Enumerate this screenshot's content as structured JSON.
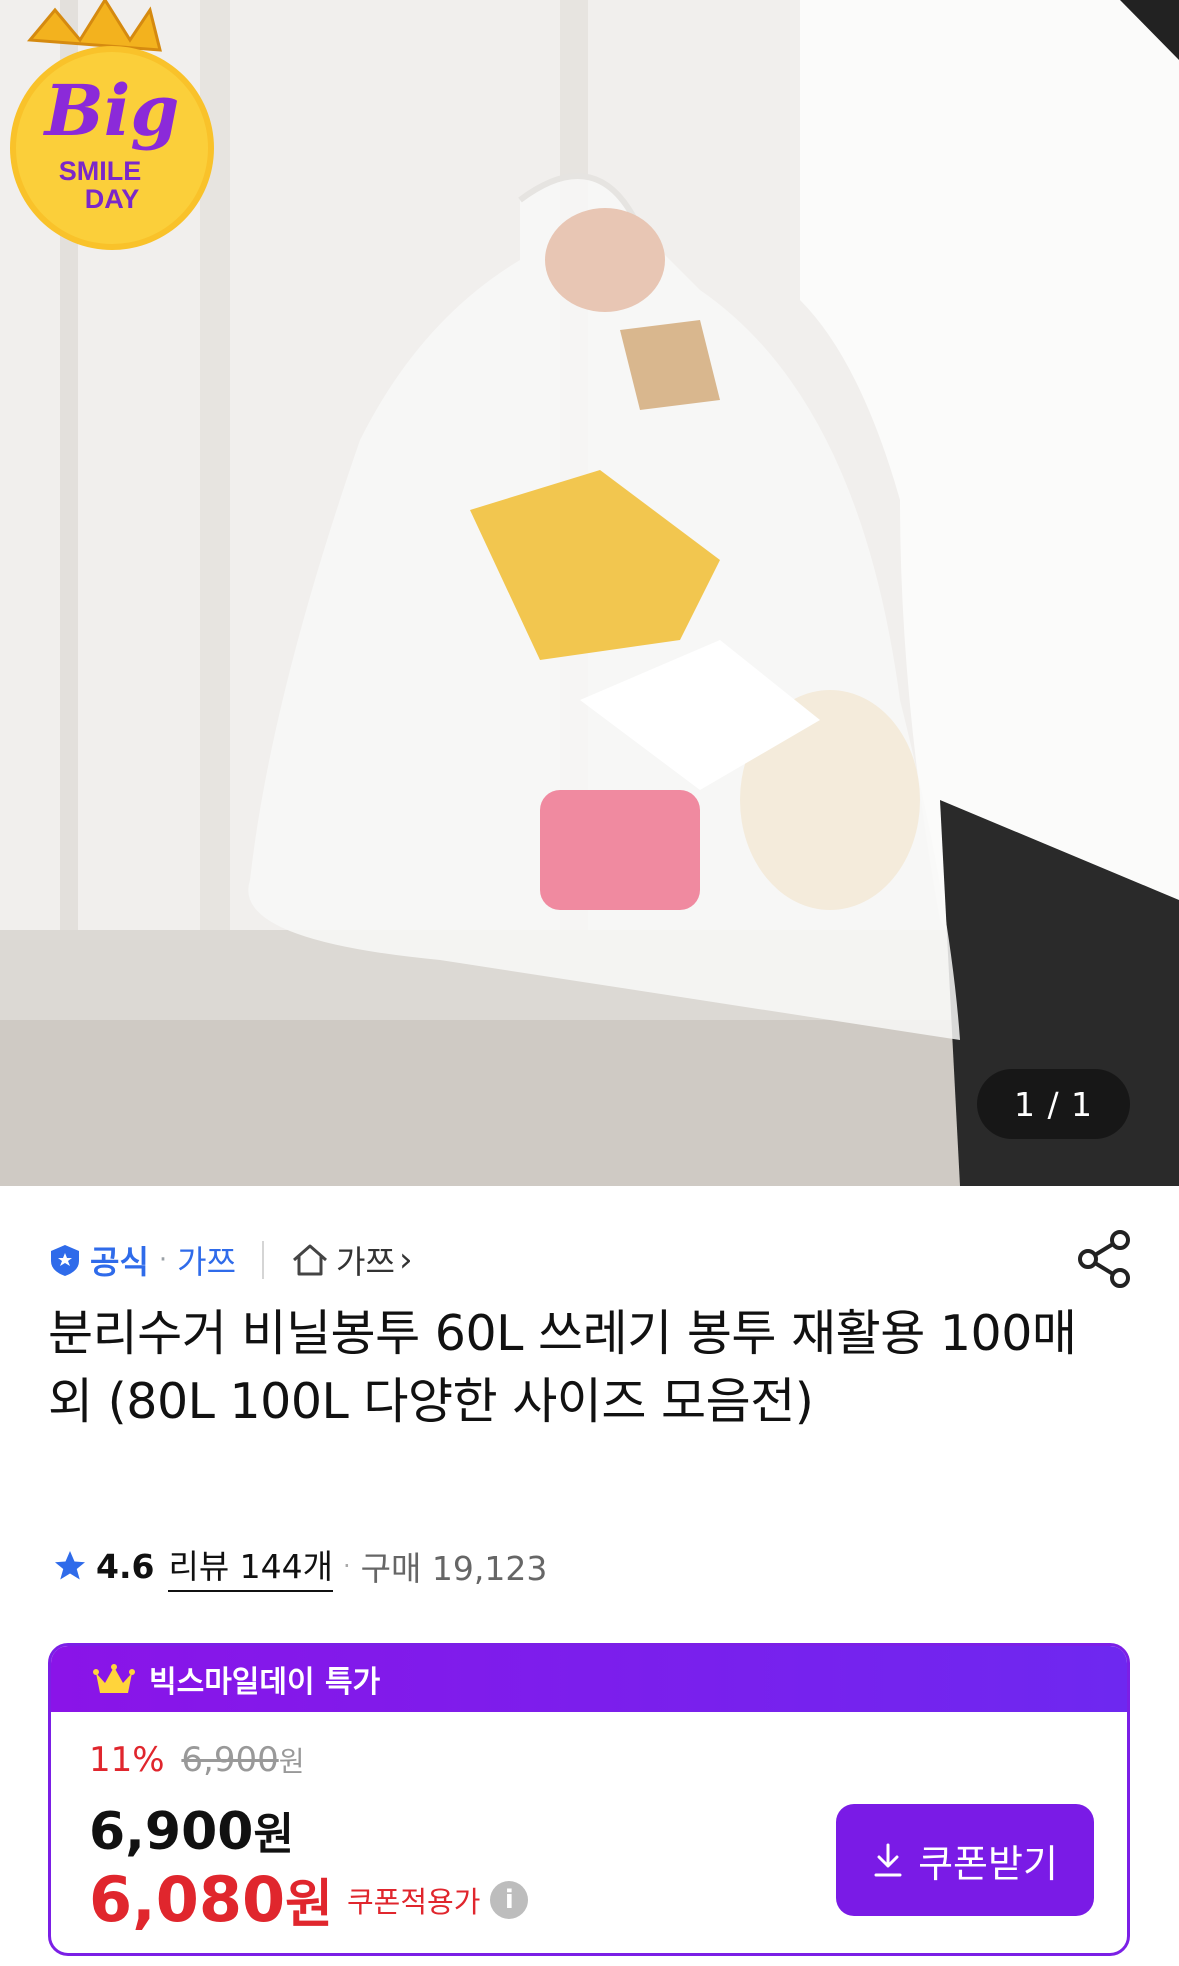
{
  "hero": {
    "image_description": "Hand holding transparent plastic bag with recyclables",
    "counter": "1 / 1",
    "badge": {
      "line1": "Big",
      "line2": "SMILE",
      "line3": "DAY"
    }
  },
  "store": {
    "official_label": "공식",
    "brand": "가쯔",
    "home_link": "가쯔",
    "chevron": "›"
  },
  "product": {
    "title": "분리수거 비닐봉투 60L 쓰레기 봉투 재활용 100매 외 (80L 100L 다양한 사이즈 모음전)"
  },
  "rating": {
    "score": "4.6",
    "review_label": "리뷰 144개",
    "purchase_label": "구매 19,123"
  },
  "promo": {
    "header": "빅스마일데이 특가",
    "discount_pct": "11%",
    "original_price": "6,900",
    "original_unit": "원",
    "sale_price": "6,900",
    "sale_unit": "원",
    "coupon_price": "6,080",
    "coupon_unit": "원",
    "coupon_label": "쿠폰적용가",
    "info_symbol": "i",
    "coupon_button": "쿠폰받기"
  },
  "colors": {
    "accent_purple": "#7a1be6",
    "price_red": "#e0262d",
    "link_blue": "#2f6bea"
  }
}
